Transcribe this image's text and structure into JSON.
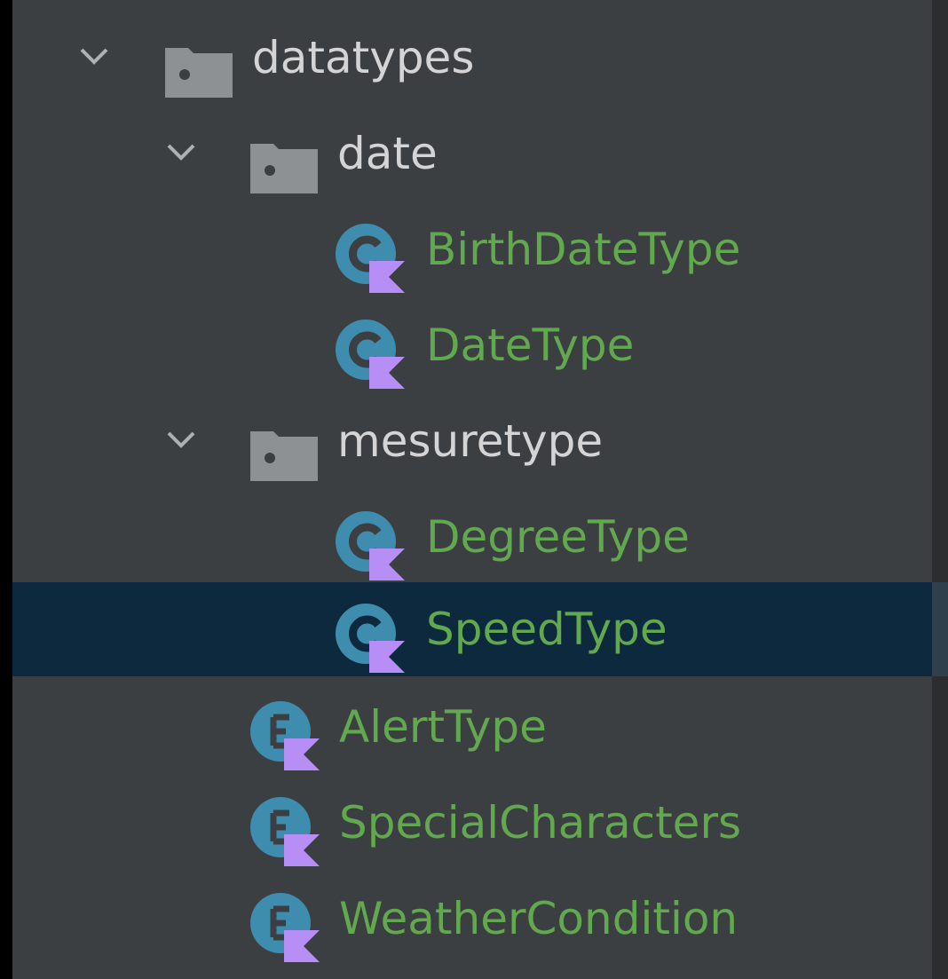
{
  "tree": {
    "datatypes": {
      "label": "datatypes",
      "icon": "package-folder-icon",
      "expanded": true
    },
    "date": {
      "label": "date",
      "icon": "package-folder-icon",
      "expanded": true
    },
    "birth_date_type": {
      "label": "BirthDateType",
      "icon": "kotlin-class-icon"
    },
    "date_type": {
      "label": "DateType",
      "icon": "kotlin-class-icon"
    },
    "mesuretype": {
      "label": "mesuretype",
      "icon": "package-folder-icon",
      "expanded": true
    },
    "degree_type": {
      "label": "DegreeType",
      "icon": "kotlin-class-icon"
    },
    "speed_type": {
      "label": "SpeedType",
      "icon": "kotlin-class-icon",
      "selected": true
    },
    "alert_type": {
      "label": "AlertType",
      "icon": "kotlin-enum-icon"
    },
    "special_characters": {
      "label": "SpecialCharacters",
      "icon": "kotlin-enum-icon"
    },
    "weather_condition": {
      "label": "WeatherCondition",
      "icon": "kotlin-enum-icon"
    }
  },
  "colors": {
    "panel_background": "#3c3f41",
    "selection_background": "#0d293e",
    "package_text": "#d4d4d4",
    "class_text": "#62a84e",
    "icon_teal": "#3e8dae",
    "icon_purple": "#b78ef6",
    "folder_gray": "#8d9194"
  }
}
